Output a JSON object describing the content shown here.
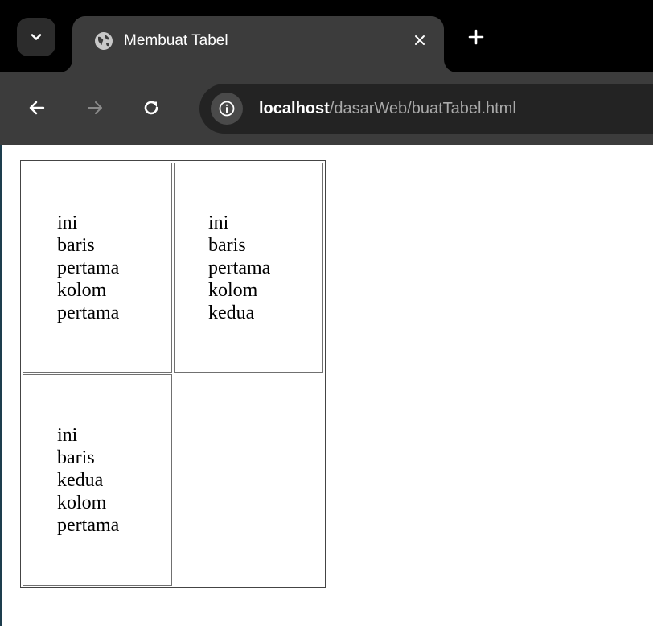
{
  "browser": {
    "tab": {
      "title": "Membuat Tabel",
      "favicon": "globe-icon",
      "close": "close-icon"
    },
    "new_tab": "plus-icon",
    "tab_search": "chevron-down-icon",
    "nav": {
      "back": "arrow-left-icon",
      "forward": "arrow-right-icon",
      "reload": "reload-icon"
    },
    "address": {
      "site_info": "info-icon",
      "host": "localhost",
      "path": "/dasarWeb/buatTabel.html"
    }
  },
  "page": {
    "table": {
      "rows": [
        [
          "ini baris pertama kolom pertama",
          "ini baris pertama kolom kedua"
        ],
        [
          "ini baris kedua kolom pertama",
          ""
        ]
      ]
    }
  },
  "colors": {
    "tabstrip": "#000000",
    "toolbar": "#3c3c3c",
    "omnibox": "#232323",
    "url_path": "#a9a9a9",
    "text": "#ffffff"
  }
}
